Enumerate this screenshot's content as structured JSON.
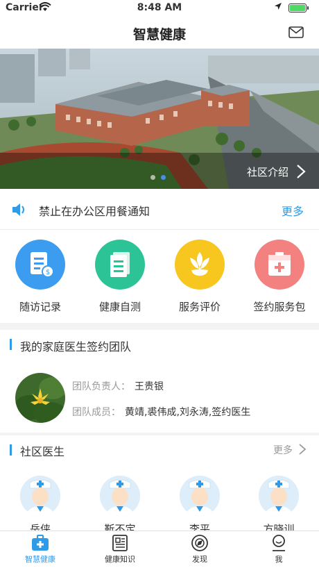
{
  "status_bar": {
    "carrier": "Carrier",
    "time": "8:48 AM"
  },
  "nav": {
    "title": "智慧健康",
    "mail_icon": "mail-icon"
  },
  "banner": {
    "caption": "社区介绍",
    "dots": 2,
    "active_dot": 1
  },
  "notice": {
    "text": "禁止在办公区用餐通知",
    "more": "更多",
    "icon": "speaker-icon",
    "accent": "#2f9be8"
  },
  "quick_actions": [
    {
      "label": "随访记录",
      "icon": "document-icon",
      "color": "#3b9cf0"
    },
    {
      "label": "健康自测",
      "icon": "paper-icon",
      "color": "#2cc496"
    },
    {
      "label": "服务评价",
      "icon": "flower-icon",
      "color": "#f7c61f"
    },
    {
      "label": "签约服务包",
      "icon": "medical-kit-icon",
      "color": "#f2817f"
    }
  ],
  "team": {
    "heading": "我的家庭医生签约团队",
    "leader_label": "团队负责人：",
    "leader": "王贵银",
    "members_label": "团队成员：",
    "members": "黄靖,裘伟成,刘永涛,签约医生"
  },
  "doctors": {
    "heading": "社区医生",
    "more": "更多",
    "items": [
      {
        "name": "岳侠"
      },
      {
        "name": "靳不定"
      },
      {
        "name": "李平"
      },
      {
        "name": "方晓训"
      }
    ]
  },
  "tabs": [
    {
      "label": "智慧健康",
      "icon": "medical-kit-icon",
      "active": true
    },
    {
      "label": "健康知识",
      "icon": "news-icon",
      "active": false
    },
    {
      "label": "发现",
      "icon": "compass-icon",
      "active": false
    },
    {
      "label": "我",
      "icon": "person-icon",
      "active": false
    }
  ]
}
